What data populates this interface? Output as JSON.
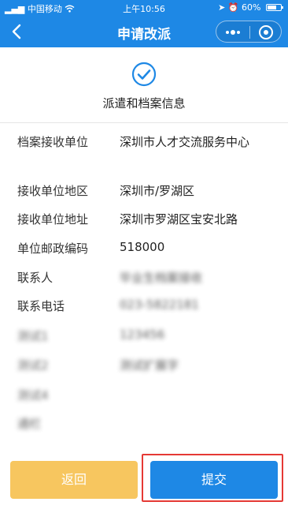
{
  "status_bar": {
    "carrier": "中国移动",
    "time": "上午10:56",
    "battery": "60%",
    "battery_level": 0.6
  },
  "nav": {
    "title": "申请改派"
  },
  "section": {
    "title": "派遣和档案信息"
  },
  "fields": [
    {
      "label": "档案接收单位",
      "value": "深圳市人才交流服务中心"
    },
    {
      "label": "接收单位地区",
      "value": "深圳市/罗湖区"
    },
    {
      "label": "接收单位地址",
      "value": "深圳市罗湖区宝安北路"
    },
    {
      "label": "单位邮政编码",
      "value": "518000"
    },
    {
      "label": "联系人",
      "value": "毕业生档案接收"
    },
    {
      "label": "联系电话",
      "value": "023-5822181"
    },
    {
      "label": "测试1",
      "value": "123456"
    },
    {
      "label": "测试2",
      "value": "测试扩展字"
    },
    {
      "label": "测试4",
      "value": ""
    },
    {
      "label": "通栏",
      "value": ""
    }
  ],
  "buttons": {
    "back": "返回",
    "submit": "提交"
  },
  "colors": {
    "primary": "#1e88e5",
    "back_button": "#f7c65f",
    "highlight": "#e53935"
  }
}
